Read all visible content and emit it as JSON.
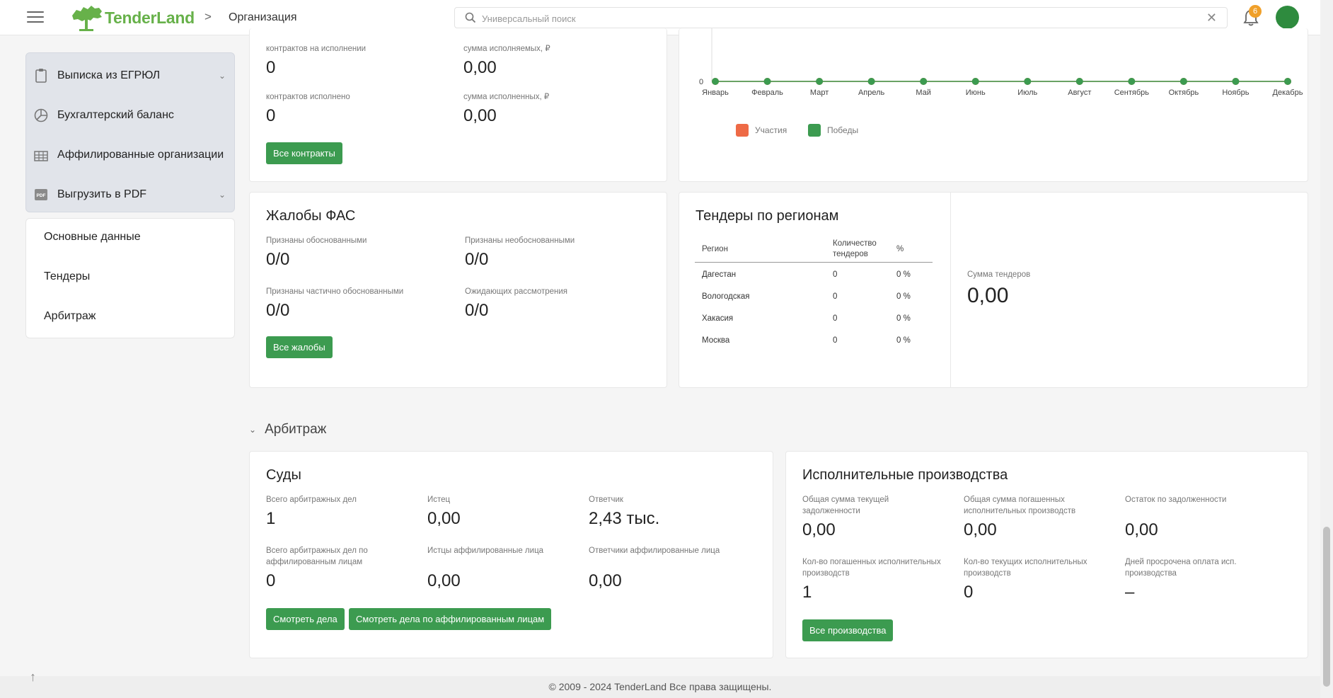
{
  "header": {
    "logo_text": "TenderLand",
    "breadcrumb": "Организация",
    "breadcrumb_sep": ">",
    "search_placeholder": "Универсальный поиск",
    "notif_count": "6",
    "accent": "#3c9b50"
  },
  "sidebar": {
    "actions": [
      {
        "label": "Выписка из ЕГРЮЛ",
        "icon": "clipboard-icon",
        "has_chevron": true
      },
      {
        "label": "Бухгалтерский баланс",
        "icon": "pie-chart-icon",
        "has_chevron": false
      },
      {
        "label": "Аффилированные организации",
        "icon": "building-icon",
        "has_chevron": false
      },
      {
        "label": "Выгрузить в PDF",
        "icon": "pdf-icon",
        "has_chevron": true
      }
    ],
    "nav": [
      "Основные данные",
      "Тендеры",
      "Арбитраж"
    ]
  },
  "contracts": {
    "l1": "контрактов на исполнении",
    "v1": "0",
    "l2": "сумма исполняемых, ₽",
    "v2": "0,00",
    "l3": "контрактов исполнено",
    "v3": "0",
    "l4": "сумма исполненных, ₽",
    "v4": "0,00",
    "button": "Все контракты"
  },
  "chart_data": {
    "type": "line",
    "categories": [
      "Январь",
      "Февраль",
      "Март",
      "Апрель",
      "Май",
      "Июнь",
      "Июль",
      "Август",
      "Сентябрь",
      "Октябрь",
      "Ноябрь",
      "Декабрь"
    ],
    "series": [
      {
        "name": "Участия",
        "color": "#ee6a46",
        "values": [
          0,
          0,
          0,
          0,
          0,
          0,
          0,
          0,
          0,
          0,
          0,
          0
        ]
      },
      {
        "name": "Победы",
        "color": "#3c9b50",
        "values": [
          0,
          0,
          0,
          0,
          0,
          0,
          0,
          0,
          0,
          0,
          0,
          0
        ]
      }
    ],
    "y_tick": "0",
    "legend_position": "bottom-left"
  },
  "fas": {
    "title": "Жалобы ФАС",
    "l1": "Признаны обоснованными",
    "v1": "0/0",
    "l2": "Признаны необоснованными",
    "v2": "0/0",
    "l3": "Признаны частично обоснованными",
    "v3": "0/0",
    "l4": "Ожидающих рассмотрения",
    "v4": "0/0",
    "button": "Все жалобы"
  },
  "regions": {
    "title": "Тендеры по регионам",
    "col_region": "Регион",
    "col_count_1": "Количество",
    "col_count_2": "тендеров",
    "col_pct": "%",
    "rows": [
      {
        "region": "Дагестан",
        "count": "0",
        "pct": "0 %"
      },
      {
        "region": "Вологодская",
        "count": "0",
        "pct": "0 %"
      },
      {
        "region": "Хакасия",
        "count": "0",
        "pct": "0 %"
      },
      {
        "region": "Москва",
        "count": "0",
        "pct": "0 %"
      }
    ],
    "sum_label": "Сумма тендеров",
    "sum_value": "0,00"
  },
  "arbitrage_section": "Арбитраж",
  "courts": {
    "title": "Суды",
    "l1": "Всего арбитражных дел",
    "v1": "1",
    "l2": "Истец",
    "v2": "0,00",
    "l3": "Ответчик",
    "v3": "2,43 тыс.",
    "l4a": "Всего арбитражных дел по",
    "l4b": "аффилированным лицам",
    "v4": "0",
    "l5": "Истцы аффилированные лица",
    "v5": "0,00",
    "l6": "Ответчики аффилированные лица",
    "v6": "0,00",
    "btn1": "Смотреть дела",
    "btn2": "Смотреть дела по аффилированным лицам"
  },
  "enforcement": {
    "title": "Исполнительные производства",
    "l1a": "Общая сумма текущей",
    "l1b": "задолженности",
    "v1": "0,00",
    "l2a": "Общая сумма погашенных",
    "l2b": "исполнительных производств",
    "v2": "0,00",
    "l3": "Остаток по задолженности",
    "v3": "0,00",
    "l4a": "Кол-во погашенных исполнительных",
    "l4b": "производств",
    "v4": "1",
    "l5a": "Кол-во текущих исполнительных",
    "l5b": "производств",
    "v5": "0",
    "l6a": "Дней просрочена оплата исп.",
    "l6b": "производства",
    "v6": "–",
    "button": "Все производства"
  },
  "footer": "© 2009 - 2024 TenderLand Все права защищены.",
  "to_top": "↑"
}
